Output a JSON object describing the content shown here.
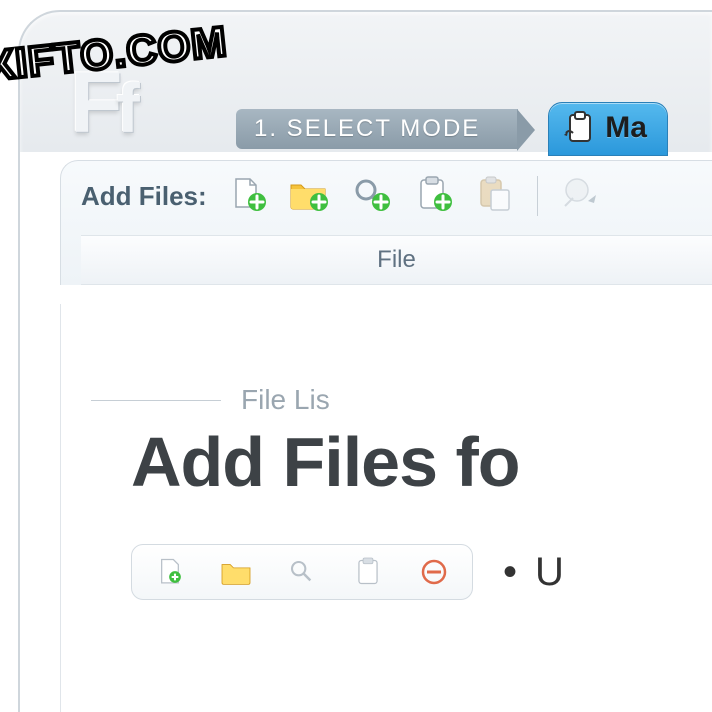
{
  "watermark": "XIFTO.COM",
  "logo": {
    "big": "F",
    "small": "f"
  },
  "breadcrumb": {
    "step1": "1. SELECT MODE"
  },
  "tabs": {
    "active_label": "Ma"
  },
  "toolbar": {
    "add_files_label": "Add Files:",
    "icons": {
      "add_file": "add-file-icon",
      "add_folder": "add-folder-icon",
      "add_search": "add-search-icon",
      "add_clipboard": "add-clipboard-icon",
      "paste": "paste-icon",
      "clear": "clear-icon"
    }
  },
  "columns": {
    "file": "File"
  },
  "empty_state": {
    "subtitle": "File Lis",
    "heading": "Add Files fo",
    "bullet_text": "U"
  },
  "colors": {
    "accent_blue": "#2b98db",
    "green": "#3fbf3f",
    "orange": "#f5a623",
    "grey_text": "#4a6070"
  }
}
